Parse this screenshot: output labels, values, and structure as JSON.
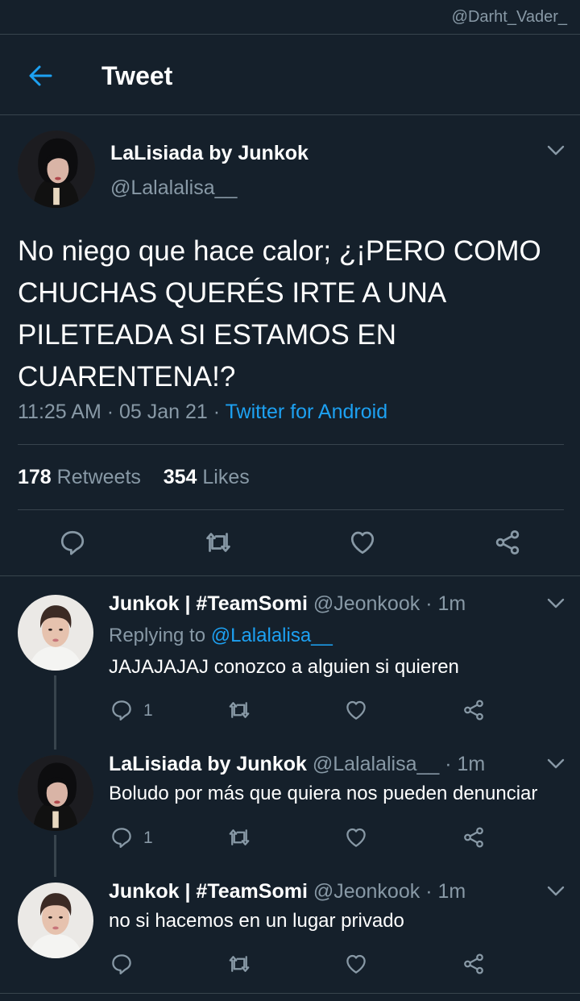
{
  "watermark": "@Darht_Vader_",
  "header": {
    "title": "Tweet"
  },
  "main_tweet": {
    "name": "LaLisiada by Junkok",
    "handle": "@Lalalalisa__",
    "text": "No niego que hace calor; ¿¡PERO COMO CHUCHAS QUERÉS IRTE A UNA PILETEADA SI ESTAMOS EN CUARENTENA!?",
    "time": "11:25 AM",
    "date": "05 Jan 21",
    "source": "Twitter for Android",
    "retweets_count": "178",
    "retweets_label": "Retweets",
    "likes_count": "354",
    "likes_label": "Likes"
  },
  "replies": [
    {
      "name": "Junkok | #TeamSomi",
      "handle": "@Jeonkook",
      "time": "1m",
      "replying_label": "Replying to",
      "replying_to": "@Lalalalisa__",
      "text": "JAJAJAJAJ conozco a alguien si quieren",
      "reply_count": "1"
    },
    {
      "name": "LaLisiada by Junkok",
      "handle": "@Lalalalisa__",
      "time": "1m",
      "text": "Boludo por más que quiera nos pueden denunciar",
      "reply_count": "1"
    },
    {
      "name": "Junkok | #TeamSomi",
      "handle": "@Jeonkook",
      "time": "1m",
      "text": "no si hacemos en un lugar privado",
      "reply_count": ""
    }
  ],
  "colors": {
    "background": "#15202b",
    "accent": "#1da1f2",
    "muted": "#8899a6",
    "divider": "#38444d"
  },
  "icons": [
    "back-arrow-icon",
    "chevron-down-icon",
    "reply-icon",
    "retweet-icon",
    "like-icon",
    "share-icon"
  ]
}
